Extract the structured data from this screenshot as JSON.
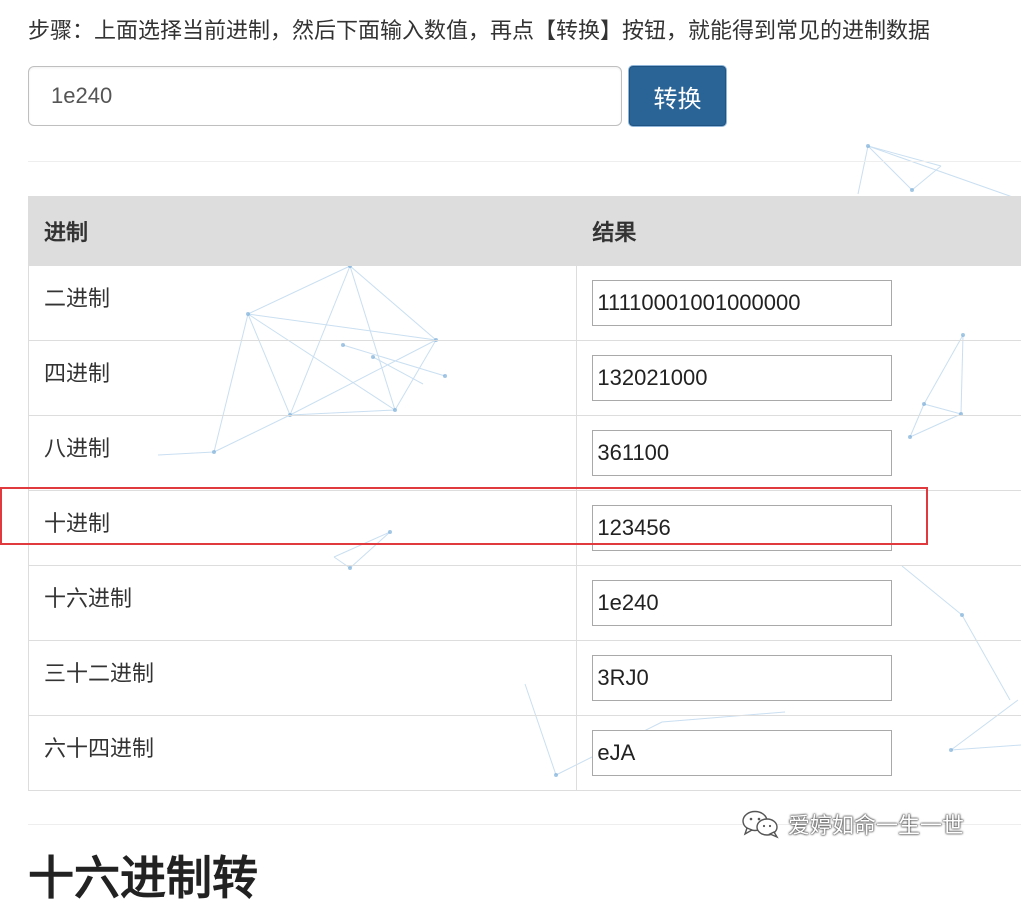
{
  "steps_text": "步骤：上面选择当前进制，然后下面输入数值，再点【转换】按钮，就能得到常见的进制数据",
  "input": {
    "value": "1e240",
    "button_label": "转换"
  },
  "table": {
    "headers": [
      "进制",
      "结果"
    ],
    "rows": [
      {
        "base": "二进制",
        "result": "11110001001000000"
      },
      {
        "base": "四进制",
        "result": "132021000"
      },
      {
        "base": "八进制",
        "result": "361100"
      },
      {
        "base": "十进制",
        "result": "123456"
      },
      {
        "base": "十六进制",
        "result": "1e240"
      },
      {
        "base": "三十二进制",
        "result": "3RJ0"
      },
      {
        "base": "六十四进制",
        "result": "eJA"
      }
    ]
  },
  "highlighted_row": "十进制",
  "watermark": {
    "icon": "wechat-icon",
    "text": "爱婷如命一生一世"
  },
  "bottom_heading": "十六进制转",
  "colors": {
    "button_bg": "#2a6496",
    "header_bg": "#dddddd",
    "highlight_border": "#e0393e",
    "network_lines": "#9ec5e6"
  }
}
